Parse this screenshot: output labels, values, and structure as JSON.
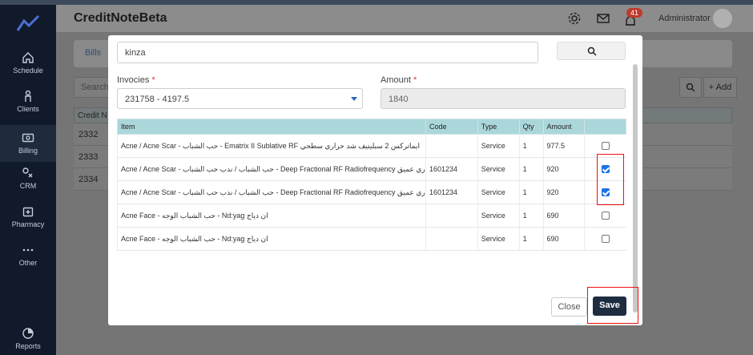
{
  "app": {
    "title": "CreditNoteBeta",
    "user": "Administrator",
    "notification_count": "41"
  },
  "sidebar": {
    "items": [
      {
        "label": "Schedule",
        "icon": "home-icon"
      },
      {
        "label": "Clients",
        "icon": "person-icon"
      },
      {
        "label": "Billing",
        "icon": "billing-icon"
      },
      {
        "label": "CRM",
        "icon": "crm-icon"
      },
      {
        "label": "Pharmacy",
        "icon": "pharmacy-icon"
      },
      {
        "label": "Other",
        "icon": "more-icon"
      },
      {
        "label": "Reports",
        "icon": "reports-icon"
      }
    ]
  },
  "background": {
    "tab": "Bills",
    "search_placeholder": "Search",
    "add_label": "Add",
    "table_header": "Credit N",
    "rows": [
      "2332",
      "2333",
      "2334"
    ]
  },
  "modal": {
    "search_value": "kinza",
    "invoices_label": "Invocies",
    "invoices_value": "231758 - 4197.5",
    "amount_label": "Amount",
    "amount_value": "1840",
    "required_mark": "*",
    "columns": [
      "Item",
      "Code",
      "Type",
      "Qty",
      "Amount"
    ],
    "rows": [
      {
        "item": "Acne / Acne Scar - حب الشباب - Ematrix II Sublative RF ايماتركس 2 سبليتيف شد حراري سطحي",
        "code": "",
        "type": "Service",
        "qty": "1",
        "amount": "977.5",
        "checked": false
      },
      {
        "item": "Acne / Acne Scar - حب الشباب / ندب حب الشباب - Deep Fractional RF Radiofrequency شد الحراري عميق",
        "code": "1601234",
        "type": "Service",
        "qty": "1",
        "amount": "920",
        "checked": true
      },
      {
        "item": "Acne / Acne Scar - حب الشباب / ندب حب الشباب - Deep Fractional RF Radiofrequency شد الحراري عميق",
        "code": "1601234",
        "type": "Service",
        "qty": "1",
        "amount": "920",
        "checked": true
      },
      {
        "item": "Acne Face - حب الشباب الوجه - Nd:yag ان دياج",
        "code": "",
        "type": "Service",
        "qty": "1",
        "amount": "690",
        "checked": false
      },
      {
        "item": "Acne Face - حب الشباب الوجه - Nd:yag ان دياج",
        "code": "",
        "type": "Service",
        "qty": "1",
        "amount": "690",
        "checked": false
      }
    ],
    "close_label": "Close",
    "save_label": "Save"
  },
  "colors": {
    "sidebar": "#111a2b",
    "table_header": "#abd7db",
    "save_button": "#1e2c3f",
    "highlight": "#e11111",
    "checkbox": "#1a73e8"
  }
}
